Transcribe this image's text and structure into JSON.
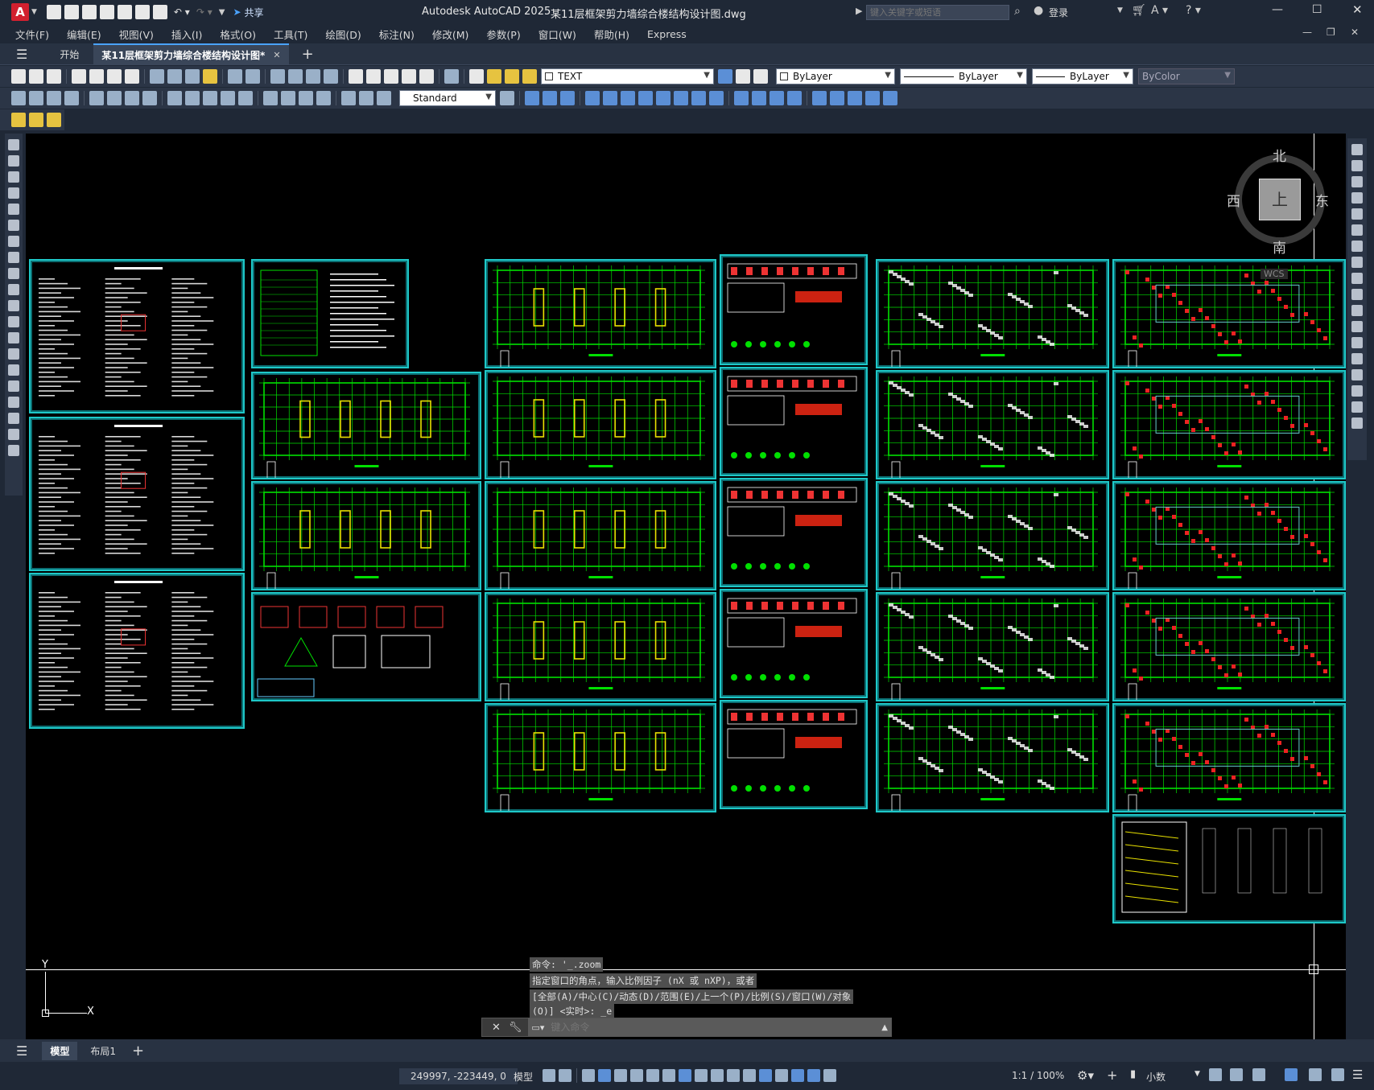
{
  "title": {
    "app": "Autodesk AutoCAD 2025",
    "file": "某11层框架剪力墙综合楼结构设计图.dwg",
    "share": "共享",
    "search_placeholder": "键入关键字或短语",
    "login": "登录"
  },
  "menu": [
    "文件(F)",
    "编辑(E)",
    "视图(V)",
    "插入(I)",
    "格式(O)",
    "工具(T)",
    "绘图(D)",
    "标注(N)",
    "修改(M)",
    "参数(P)",
    "窗口(W)",
    "帮助(H)",
    "Express"
  ],
  "tabs": {
    "start": "开始",
    "doc": "某11层框架剪力墙综合楼结构设计图*"
  },
  "toolbar": {
    "layer": "TEXT",
    "color": "ByLayer",
    "linetype": "ByLayer",
    "lineweight": "ByLayer",
    "plotstyle": "ByColor",
    "dimstyle": "Standard"
  },
  "compass": {
    "n": "北",
    "s": "南",
    "e": "东",
    "w": "西",
    "top": "上",
    "wcs": "WCS"
  },
  "ucs": {
    "x": "X",
    "y": "Y"
  },
  "command": {
    "history": [
      "命令: '_.zoom",
      "指定窗口的角点，输入比例因子 (nX 或 nXP)，或者",
      "[全部(A)/中心(C)/动态(D)/范围(E)/上一个(P)/比例(S)/窗口(W)/对象",
      "(O)] <实时>: _e"
    ],
    "placeholder": "键入命令"
  },
  "layouts": [
    "模型",
    "布局1"
  ],
  "status": {
    "coords": "249997, -223449, 0",
    "mode": "模型",
    "scale": "1:1 / 100%",
    "units": "小数"
  },
  "colors": {
    "frame": "#1ec8c8",
    "grid": "#00e000",
    "wall": "#e8e000",
    "bg": "#000000",
    "ui": "#1f2836"
  }
}
